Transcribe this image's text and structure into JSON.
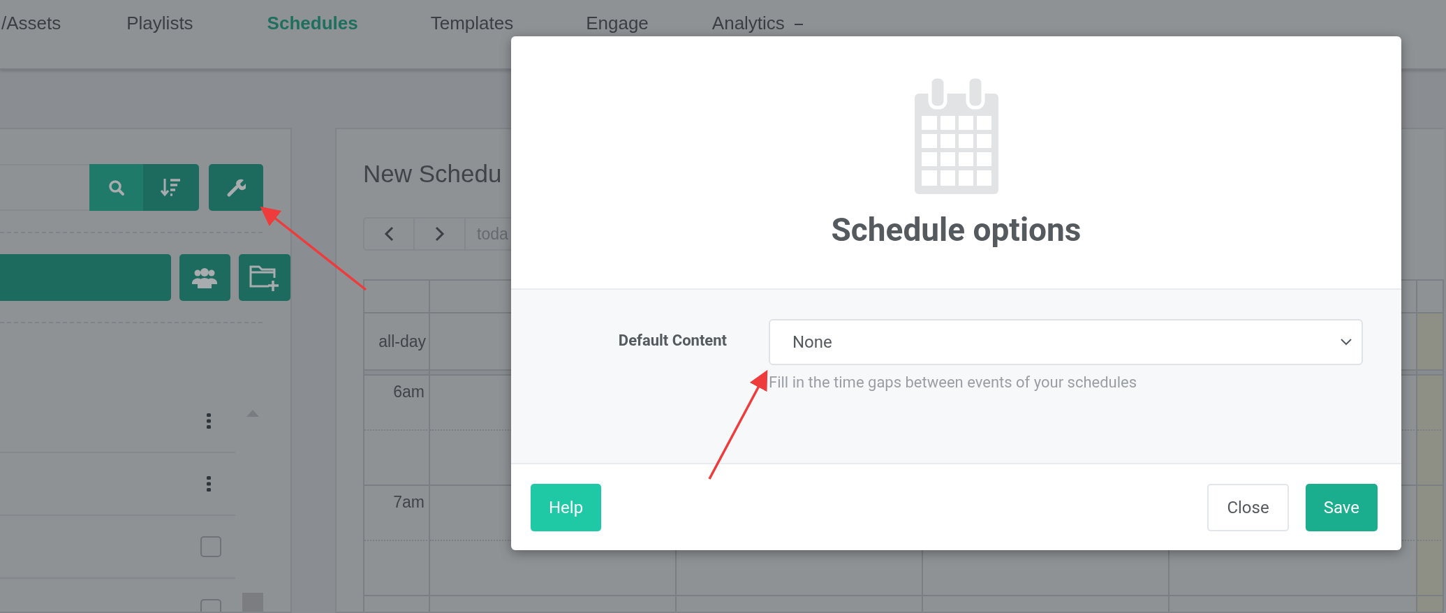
{
  "nav": {
    "items": [
      {
        "label": "/Assets",
        "selected": false,
        "kind": "link"
      },
      {
        "label": "Playlists",
        "selected": false,
        "kind": "link"
      },
      {
        "label": "Schedules",
        "selected": true,
        "kind": "link"
      },
      {
        "label": "Templates",
        "selected": false,
        "kind": "link"
      },
      {
        "label": "Engage",
        "selected": false,
        "kind": "link"
      },
      {
        "label": "Analytics",
        "selected": false,
        "kind": "dropdown"
      }
    ]
  },
  "sidebar": {
    "rows": [
      {
        "kind": "menu"
      },
      {
        "kind": "menu"
      },
      {
        "kind": "checkbox",
        "checked": false
      },
      {
        "kind": "checkbox",
        "checked": false
      }
    ]
  },
  "calendar": {
    "title": "New Schedu",
    "today_button": "toda",
    "all_day_label": "all-day",
    "time_slots": [
      "6am",
      "7am"
    ]
  },
  "modal": {
    "title": "Schedule options",
    "field": {
      "label": "Default Content",
      "value": "None",
      "hint": "Fill in the time gaps between events of your schedules"
    },
    "buttons": [
      {
        "label": "Help",
        "kind": "help"
      },
      {
        "label": "Close",
        "kind": "secondary"
      },
      {
        "label": "Save",
        "kind": "primary"
      }
    ]
  }
}
